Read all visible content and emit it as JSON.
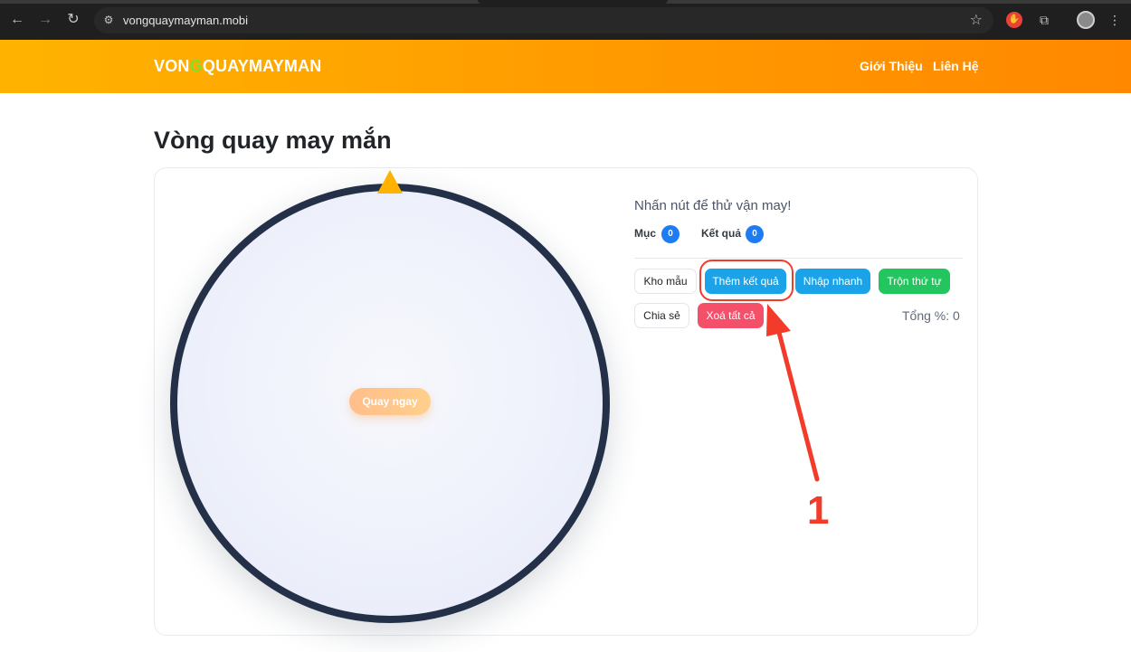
{
  "browser": {
    "url": "vongquaymayman.mobi",
    "icons": [
      "back-icon",
      "forward-icon",
      "reload-icon",
      "site-info-icon",
      "bookmark-star-icon",
      "extension-icon",
      "puzzle-extensions-icon",
      "profile-avatar",
      "menu-kebab-icon"
    ]
  },
  "header": {
    "logo_left": "VON",
    "logo_accent": "G",
    "logo_right": "QUAYMAYMAN",
    "nav": [
      "Giới Thiệu",
      "Liên Hệ"
    ],
    "gradient": [
      "#ffb300",
      "#ff8800"
    ]
  },
  "main": {
    "title": "Vòng quay may mắn",
    "wheel": {
      "spin_label": "Quay ngay",
      "rim_color": "#243048",
      "pointer_color": "#ffb300"
    },
    "prompt": "Nhấn nút để thử vận may!",
    "stats": [
      {
        "label": "Mục",
        "value": "0"
      },
      {
        "label": "Kết quả",
        "value": "0"
      }
    ],
    "buttons": {
      "templates": "Kho mẫu",
      "add_result": "Thêm kết quả",
      "quick_input": "Nhập nhanh",
      "shuffle": "Trộn thứ tự",
      "share": "Chia sẻ",
      "clear_all": "Xoá tất cả"
    },
    "total": "Tổng %: 0"
  },
  "annotation": {
    "number": "1",
    "color": "#f23b2a"
  }
}
